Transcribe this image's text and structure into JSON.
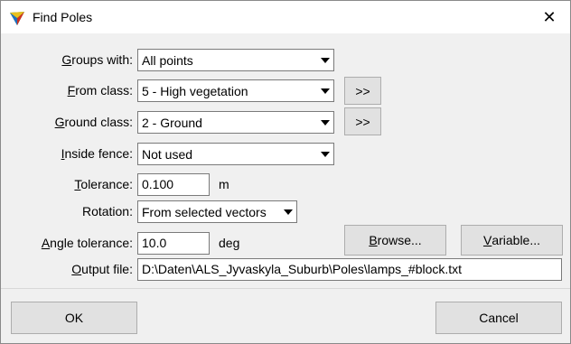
{
  "window": {
    "title": "Find Poles",
    "close_glyph": "✕"
  },
  "fields": {
    "groups_with": {
      "label_ul": "G",
      "label_rest": "roups with:",
      "value": "All points"
    },
    "from_class": {
      "label_ul": "F",
      "label_rest": "rom class:",
      "value": "5 - High vegetation",
      "pick_label": ">>"
    },
    "ground_class": {
      "label_ul": "G",
      "label_rest": "round class:",
      "value": "2 - Ground",
      "pick_label": ">>"
    },
    "inside_fence": {
      "label_ul": "I",
      "label_rest": "nside fence:",
      "value": "Not used"
    },
    "tolerance": {
      "label_ul": "T",
      "label_rest": "olerance:",
      "value": "0.100",
      "unit": "m"
    },
    "rotation": {
      "label": "Rotation:",
      "value": "From selected vectors"
    },
    "angle_tolerance": {
      "label_ul": "A",
      "label_rest": "ngle tolerance:",
      "value": "10.0",
      "unit": "deg"
    },
    "output_file": {
      "label_ul": "O",
      "label_rest": "utput file:",
      "value": "D:\\Daten\\ALS_Jyvaskyla_Suburb\\Poles\\lamps_#block.txt"
    }
  },
  "buttons": {
    "browse": {
      "ul": "B",
      "rest": "rowse..."
    },
    "variable": {
      "ul": "V",
      "rest": "ariable..."
    },
    "ok": "OK",
    "cancel": "Cancel"
  }
}
